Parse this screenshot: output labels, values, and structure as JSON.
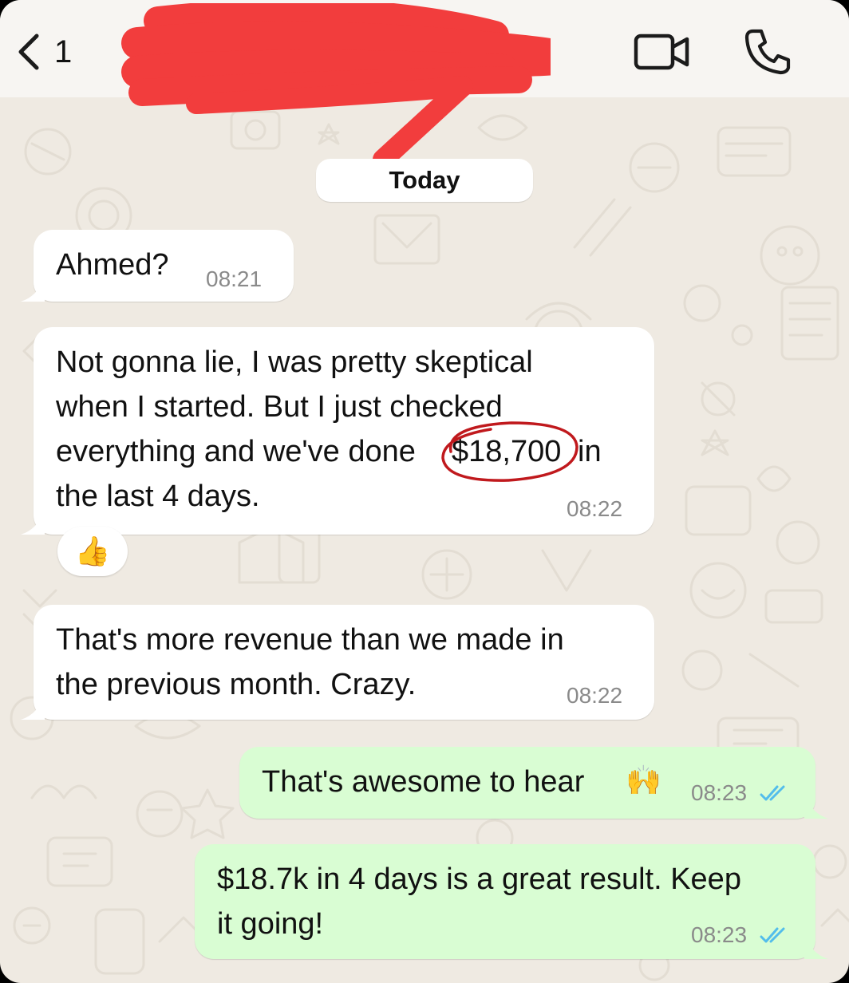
{
  "header": {
    "back_count": "1",
    "contact_name_visible": "yn",
    "colors": {
      "redaction": "#f23d3d",
      "icon": "#1b1b1b"
    },
    "icons": [
      "chevron-left-icon",
      "video-call-icon",
      "phone-icon"
    ]
  },
  "date_chip": "Today",
  "messages": [
    {
      "direction": "incoming",
      "text": "Ahmed?",
      "time": "08:21"
    },
    {
      "direction": "incoming",
      "lines": [
        "Not gonna lie, I was pretty skeptical",
        "when I started. But I just checked",
        "everything and we've done",
        "$18,700",
        "in",
        "the last 4 days."
      ],
      "time": "08:22",
      "reaction": "👍",
      "highlight_color": "#c0191d"
    },
    {
      "direction": "incoming",
      "lines": [
        "That's more revenue than we made in",
        "the  previous month. Crazy."
      ],
      "time": "08:22"
    },
    {
      "direction": "outgoing",
      "text": "That's awesome to hear",
      "emoji": "🙌",
      "time": "08:23",
      "status": "read"
    },
    {
      "direction": "outgoing",
      "lines": [
        "$18.7k in 4 days is a great  result. Keep",
        "it going!"
      ],
      "time": "08:23",
      "status": "read"
    }
  ],
  "colors": {
    "chat_background": "#efeae2",
    "incoming_bubble": "#ffffff",
    "outgoing_bubble": "#d9fdd3",
    "read_ticks": "#53bdeb"
  }
}
